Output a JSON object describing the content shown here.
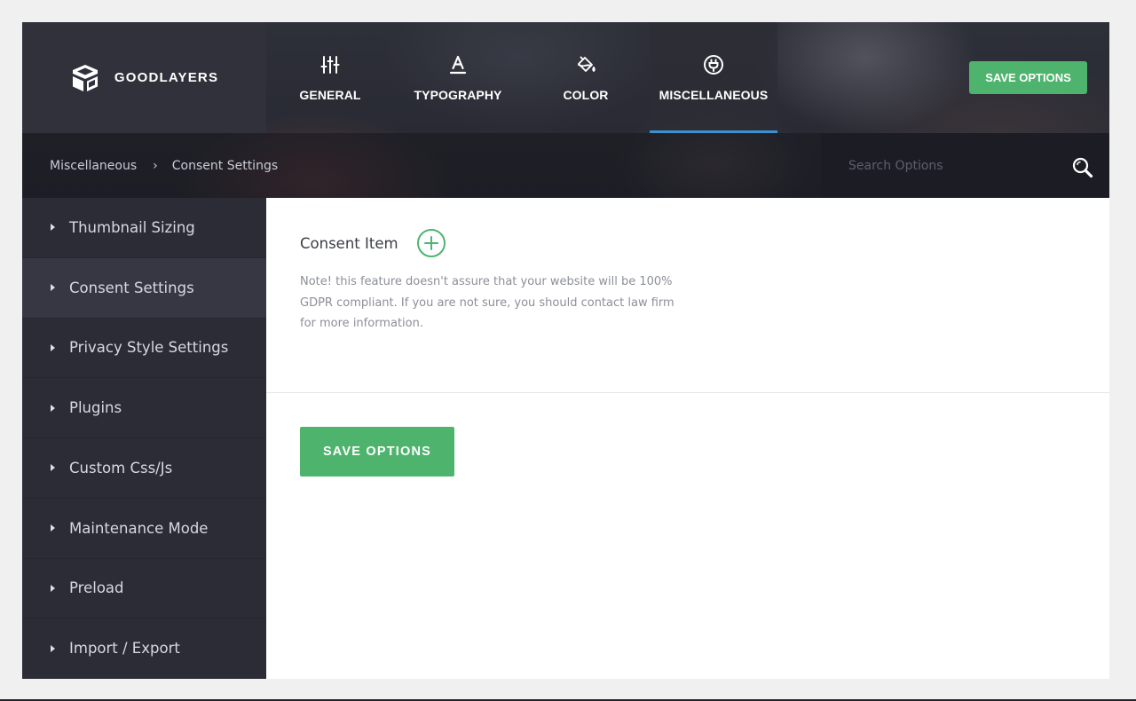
{
  "brand": {
    "name": "GOODLAYERS",
    "icon": "goodlayers-logo-icon"
  },
  "nav": {
    "tabs": [
      {
        "label": "GENERAL",
        "icon": "sliders-icon",
        "active": false
      },
      {
        "label": "TYPOGRAPHY",
        "icon": "typography-icon",
        "active": false
      },
      {
        "label": "COLOR",
        "icon": "paint-bucket-icon",
        "active": false
      },
      {
        "label": "MISCELLANEOUS",
        "icon": "plug-icon",
        "active": true
      }
    ],
    "save_label": "SAVE OPTIONS"
  },
  "breadcrumb": {
    "items": [
      "Miscellaneous",
      "Consent Settings"
    ],
    "separator": "›"
  },
  "search": {
    "placeholder": "Search Options",
    "value": "",
    "icon": "search-icon"
  },
  "sidebar": {
    "items": [
      {
        "label": "Thumbnail Sizing",
        "active": false
      },
      {
        "label": "Consent Settings",
        "active": true
      },
      {
        "label": "Privacy Style Settings",
        "active": false
      },
      {
        "label": "Plugins",
        "active": false
      },
      {
        "label": "Custom Css/Js",
        "active": false
      },
      {
        "label": "Maintenance Mode",
        "active": false
      },
      {
        "label": "Preload",
        "active": false
      },
      {
        "label": "Import / Export",
        "active": false
      }
    ]
  },
  "main": {
    "section_title": "Consent Item",
    "add_icon": "plus-circle-icon",
    "note": "Note! this feature doesn't assure that your website will be 100% GDPR compliant. If you are not sure, you should contact law firm for more information.",
    "save_label": "SAVE OPTIONS"
  },
  "colors": {
    "accent_green": "#4eb46d",
    "active_tab_underline": "#3b92d0",
    "sidebar_bg": "#2b2c36",
    "sidebar_active_bg": "#363743"
  }
}
